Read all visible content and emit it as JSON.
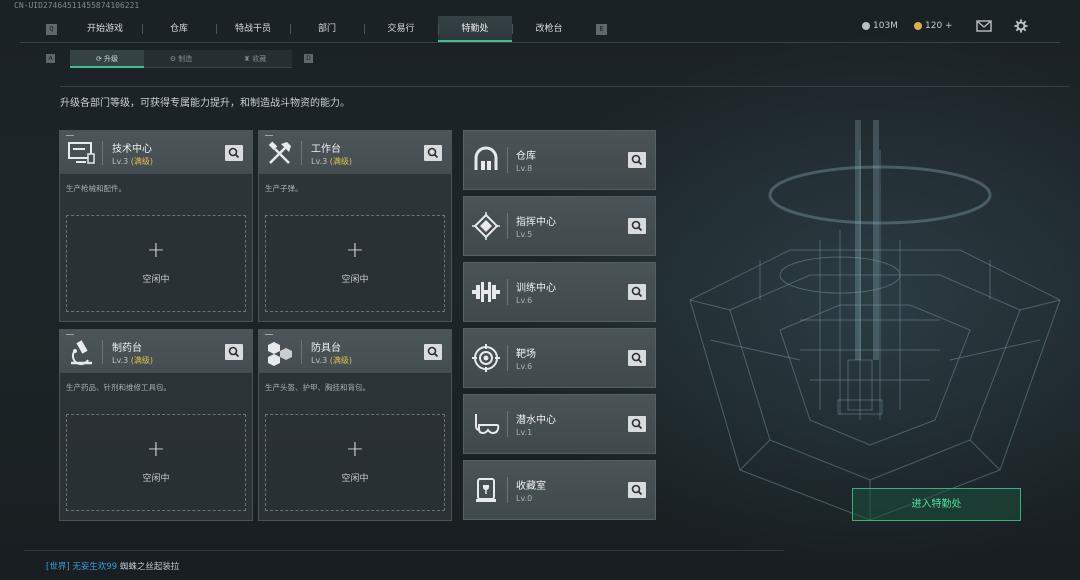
{
  "uid": "CN-UID27464511455874106221",
  "nav": {
    "left_key": "Q",
    "right_key": "E",
    "tabs": [
      {
        "label": "开始游戏"
      },
      {
        "label": "仓库"
      },
      {
        "label": "特战干员"
      },
      {
        "label": "部门"
      },
      {
        "label": "交易行"
      },
      {
        "label": "特勤处",
        "active": true
      },
      {
        "label": "改枪台"
      }
    ]
  },
  "currency": {
    "silver": "103M",
    "gold": "120 +"
  },
  "subnav": {
    "left_key": "A",
    "right_key": "D",
    "tabs": [
      {
        "label": "升级",
        "active": true
      },
      {
        "label": "制造"
      },
      {
        "label": "收藏"
      }
    ]
  },
  "description": "升级各部门等级，可获得专属能力提升，和制造战斗物资的能力。",
  "workshops": [
    {
      "title": "技术中心",
      "level": "Lv.3",
      "max": "(满级)",
      "subtitle": "生产枪械和配件。",
      "slot_status": "空闲中",
      "icon": "computer-icon"
    },
    {
      "title": "工作台",
      "level": "Lv.3",
      "max": "(满级)",
      "subtitle": "生产子弹。",
      "slot_status": "空闲中",
      "icon": "tools-icon"
    },
    {
      "title": "制药台",
      "level": "Lv.3",
      "max": "(满级)",
      "subtitle": "生产药品、针剂和维修工具包。",
      "slot_status": "空闲中",
      "icon": "microscope-icon"
    },
    {
      "title": "防具台",
      "level": "Lv.3",
      "max": "(满级)",
      "subtitle": "生产头盔、护甲、胸挂和背包。",
      "slot_status": "空闲中",
      "icon": "armor-icon"
    }
  ],
  "facilities": [
    {
      "title": "仓库",
      "level": "Lv.8",
      "icon": "warehouse-icon"
    },
    {
      "title": "指挥中心",
      "level": "Lv.5",
      "icon": "chip-icon"
    },
    {
      "title": "训练中心",
      "level": "Lv.6",
      "icon": "dumbbell-icon"
    },
    {
      "title": "靶场",
      "level": "Lv.6",
      "icon": "target-icon"
    },
    {
      "title": "潜水中心",
      "level": "Lv.1",
      "icon": "diving-mask-icon"
    },
    {
      "title": "收藏室",
      "level": "Lv.0",
      "icon": "trophy-case-icon"
    }
  ],
  "enter_button": "进入特勤处",
  "chat": {
    "channel": "[世界] 无妄生欢99",
    "message": "蜘蛛之丝起装拉"
  },
  "colors": {
    "accent": "#3ec08a",
    "max_level": "#e0c14a",
    "chat_channel": "#3c9ad6"
  }
}
